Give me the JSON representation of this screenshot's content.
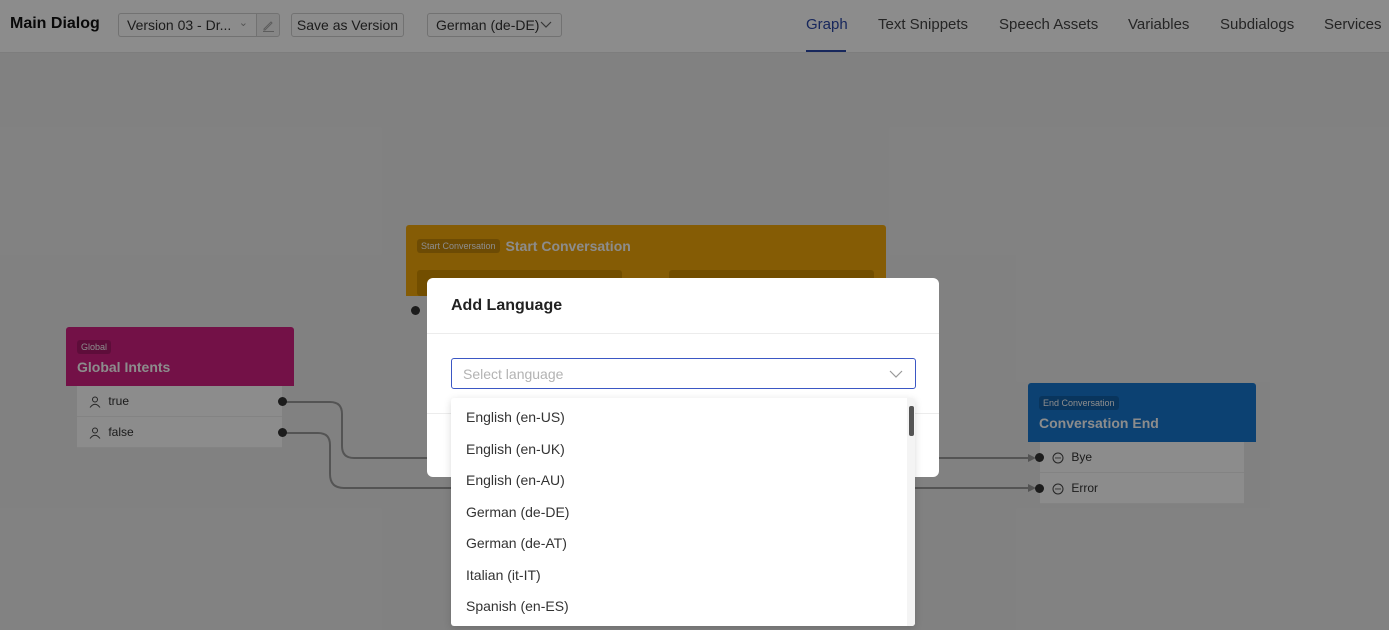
{
  "header": {
    "title": "Main Dialog",
    "version": "Version 03 - Dr...",
    "save_label": "Save as Version",
    "language": "German (de-DE)"
  },
  "tabs": [
    {
      "label": "Graph",
      "active": true
    },
    {
      "label": "Text Snippets"
    },
    {
      "label": "Speech Assets"
    },
    {
      "label": "Variables"
    },
    {
      "label": "Subdialogs"
    },
    {
      "label": "Services"
    }
  ],
  "nodes": {
    "global": {
      "badge": "Global",
      "title": "Global Intents",
      "ports": [
        "true",
        "false"
      ]
    },
    "start": {
      "badge": "Start Conversation",
      "title": "Start Conversation"
    },
    "end": {
      "badge": "End Conversation",
      "title": "Conversation End",
      "ports": [
        "Bye",
        "Error"
      ]
    }
  },
  "modal": {
    "title": "Add Language",
    "placeholder": "Select language"
  },
  "dropdown": {
    "options": [
      "English (en-US)",
      "English (en-UK)",
      "English (en-AU)",
      "German (de-DE)",
      "German (de-AT)",
      "Italian (it-IT)",
      "Spanish (en-ES)"
    ]
  },
  "colors": {
    "accent": "#2b47a8",
    "global_node": "#d21f82",
    "start_node": "#f3a80a",
    "end_node": "#1677d0"
  }
}
